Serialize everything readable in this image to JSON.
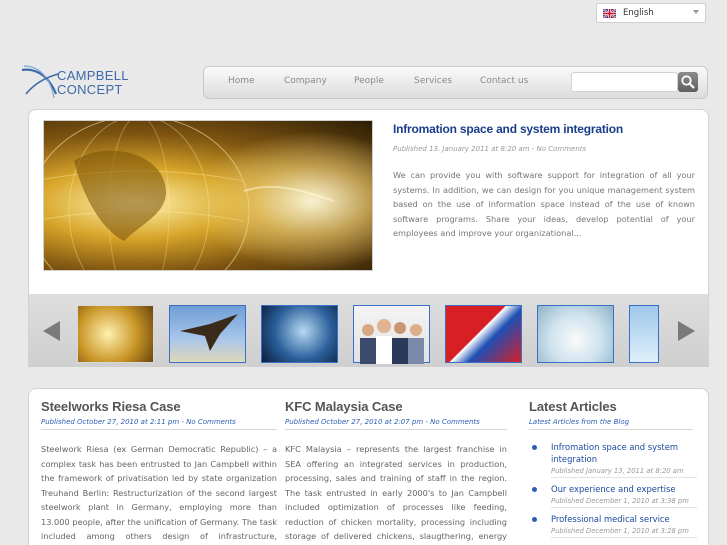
{
  "language": {
    "selected": "English"
  },
  "logo": {
    "line1": "CAMPBELL",
    "line2": "CONCEPT"
  },
  "nav": {
    "items": [
      "Home",
      "Company",
      "People",
      "Services",
      "Contact us"
    ],
    "search_placeholder": ""
  },
  "feature": {
    "title": "Infromation space and system integration",
    "meta": "Published 13. January 2011 at 8:20 am - No Comments",
    "text": "We can provide you with software support for integration of all your systems. In addition, we can design for you unique management system based on the use of information space instead of the use of known software programs. Share your ideas, develop potential of your employees and improve your organizational..."
  },
  "thumbnails": [
    "globe",
    "eagle",
    "head",
    "people",
    "flags",
    "water",
    "flower"
  ],
  "posts": [
    {
      "title": "Steelworks Riesa Case",
      "meta": "Published October 27, 2010 at 2:11 pm - No Comments",
      "body": "Steelwork Riesa (ex German Democratic Republic) – a complex task has been entrusted to Jan Campbell within the framework of privatisation led by state organization Treuhand Berlin: Restructurization of the second largest steelwork plant in Germany, employing more than 13.000 people, after the unification of Germany. The task included among others design of infrastructure, utilisation"
    },
    {
      "title": "KFC Malaysia Case",
      "meta": "Published October 27, 2010 at 2:07 pm - No Comments",
      "body": "KFC Malaysia – represents the largest franchise in SEA offering an integrated services in production, processing, sales and training of staff in the region. The task entrusted in early 2000's to Jan Campbell included optimization of processes like feeding, reduction of chicken mortality, processing including storage of delivered chickens, slaugthering, energy savings (chiller and storage),"
    }
  ],
  "latest": {
    "title": "Latest Articles",
    "subtitle": "Latest Articles from the Blog",
    "items": [
      {
        "title": "Infromation space and system integration",
        "date": "Published January 13, 2011 at 8:20 am"
      },
      {
        "title": "Our experience and expertise",
        "date": "Published December 1, 2010 at 3:38 pm"
      },
      {
        "title": "Professional medical service",
        "date": "Published December 1, 2010 at 3:28 pm"
      }
    ]
  }
}
